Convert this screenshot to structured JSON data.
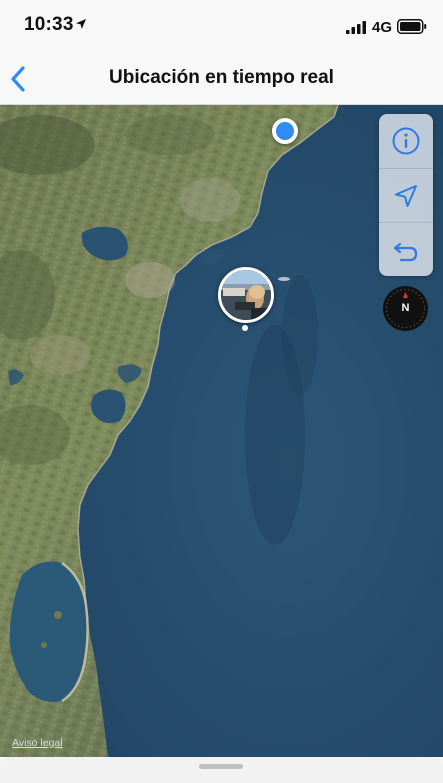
{
  "status_bar": {
    "time": "10:33",
    "network": "4G"
  },
  "nav": {
    "title": "Ubicación en tiempo real",
    "back_icon": "chevron-left-icon"
  },
  "map": {
    "legal_link": "Aviso legal",
    "compass_label": "N",
    "controls": [
      {
        "icon": "info-icon"
      },
      {
        "icon": "location-arrow-icon"
      },
      {
        "icon": "return-arrow-icon"
      }
    ]
  },
  "colors": {
    "accent": "#2f8bf5",
    "sea": "#2a4e6c",
    "land": "#6f7f55"
  }
}
